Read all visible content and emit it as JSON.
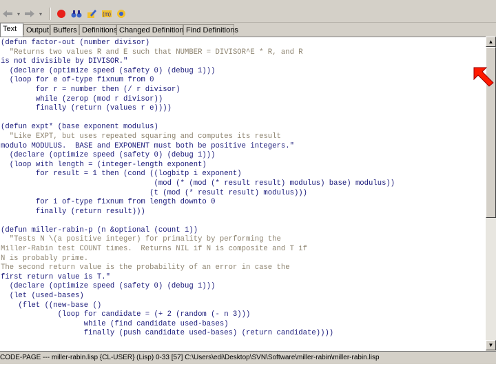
{
  "toolbar": {
    "back_icon": "back-arrow-icon",
    "forward_icon": "forward-arrow-icon",
    "stop_icon": "stop-icon",
    "buttons": [
      "back",
      "forward",
      "stop",
      "refresh",
      "edit",
      "find-symbol",
      "debug"
    ]
  },
  "tabs": [
    {
      "label": "Text",
      "active": true
    },
    {
      "label": "Output"
    },
    {
      "label": "Buffers"
    },
    {
      "label": "Definitions"
    },
    {
      "label": "Changed Definitions"
    },
    {
      "label": "Find Definitions"
    }
  ],
  "editor": {
    "lines": [
      "(defun factor-out (number divisor)",
      "  \"Returns two values R and E such that NUMBER = DIVISOR^E * R, and R",
      "is not divisible by DIVISOR.\"",
      "  (declare (optimize speed (safety 0) (debug 1)))",
      "  (loop for e of-type fixnum from 0",
      "        for r = number then (/ r divisor)",
      "        while (zerop (mod r divisor))",
      "        finally (return (values r e))))",
      "",
      "(defun expt* (base exponent modulus)",
      "  \"Like EXPT, but uses repeated squaring and computes its result",
      "modulo MODULUS.  BASE and EXPONENT must both be positive integers.\"",
      "  (declare (optimize speed (safety 0) (debug 1)))",
      "  (loop with length = (integer-length exponent)",
      "        for result = 1 then (cond ((logbitp i exponent)",
      "                                   (mod (* (mod (* result result) modulus) base) modulus))",
      "                                  (t (mod (* result result) modulus)))",
      "        for i of-type fixnum from length downto 0",
      "        finally (return result)))",
      "",
      "(defun miller-rabin-p (n &optional (count 1))",
      "  \"Tests N \\(a positive integer) for primality by performing the",
      "Miller-Rabin test COUNT times.  Returns NIL if N is composite and T if",
      "N is probably prime.",
      "",
      "The second return value is the probability of an error in case the",
      "first return value is T.\"",
      "  (declare (optimize speed (safety 0) (debug 1)))",
      "  (let (used-bases)",
      "    (flet ((new-base ()",
      "             (loop for candidate = (+ 2 (random (- n 3)))",
      "                   while (find candidate used-bases)",
      "                   finally (push candidate used-bases) (return candidate))))"
    ]
  },
  "status_bar": {
    "text": "CODE-PAGE --- miller-rabin.lisp   {CL-USER} (Lisp) 0-33 [57] C:\\Users\\edi\\Desktop\\SVN\\Software\\miller-rabin\\miller-rabin.lisp"
  }
}
